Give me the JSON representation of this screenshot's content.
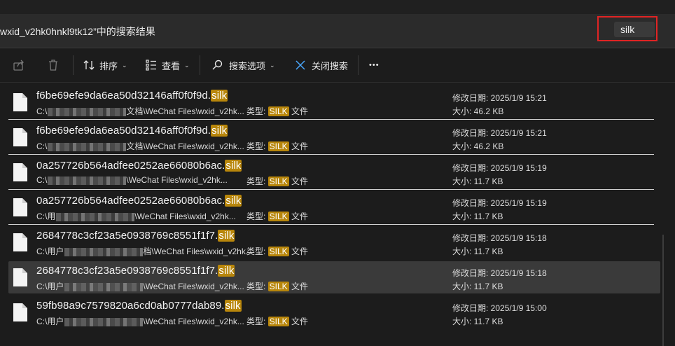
{
  "address": {
    "text": "wxid_v2hk0hnkl9tk12”中的搜索结果"
  },
  "search": {
    "value": "silk"
  },
  "toolbar": {
    "sort_label": "排序",
    "view_label": "查看",
    "search_options_label": "搜索选项",
    "close_search_label": "关闭搜索",
    "more_label": "•••"
  },
  "files": [
    {
      "name_prefix": "f6be69efe9da6ea50d32146aff0f0f9d.",
      "name_ext": "silk",
      "path_start": "C:\\",
      "path_end": "文档\\WeChat Files\\wxid_v2hk...",
      "type_label": "类型: ",
      "type_hl": "SILK",
      "type_suffix": " 文件",
      "date": "修改日期: 2025/1/9 15:21",
      "size": "大小: 46.2 KB"
    },
    {
      "name_prefix": "f6be69efe9da6ea50d32146aff0f0f9d.",
      "name_ext": "silk",
      "path_start": "C:\\",
      "path_end": "文档\\WeChat Files\\wxid_v2hk...",
      "type_label": "类型: ",
      "type_hl": "SILK",
      "type_suffix": " 文件",
      "date": "修改日期: 2025/1/9 15:21",
      "size": "大小: 46.2 KB"
    },
    {
      "name_prefix": "0a257726b564adfee0252ae66080b6ac.",
      "name_ext": "silk",
      "path_start": "C:\\",
      "path_end": "\\WeChat Files\\wxid_v2hk...",
      "type_label": "类型: ",
      "type_hl": "SILK",
      "type_suffix": " 文件",
      "date": "修改日期: 2025/1/9 15:19",
      "size": "大小: 11.7 KB"
    },
    {
      "name_prefix": "0a257726b564adfee0252ae66080b6ac.",
      "name_ext": "silk",
      "path_start": "C:\\用",
      "path_end": "\\WeChat Files\\wxid_v2hk...",
      "type_label": "类型: ",
      "type_hl": "SILK",
      "type_suffix": " 文件",
      "date": "修改日期: 2025/1/9 15:19",
      "size": "大小: 11.7 KB"
    },
    {
      "name_prefix": "2684778c3cf23a5e0938769c8551f1f7.",
      "name_ext": "silk",
      "path_start": "C:\\用户",
      "path_end": "档\\WeChat Files\\wxid_v2hk...",
      "type_label": "类型: ",
      "type_hl": "SILK",
      "type_suffix": " 文件",
      "date": "修改日期: 2025/1/9 15:18",
      "size": "大小: 11.7 KB"
    },
    {
      "name_prefix": "2684778c3cf23a5e0938769c8551f1f7.",
      "name_ext": "silk",
      "path_start": "C:\\用户",
      "path_end": "\\WeChat Files\\wxid_v2hk...",
      "type_label": "类型: ",
      "type_hl": "SILK",
      "type_suffix": " 文件",
      "date": "修改日期: 2025/1/9 15:18",
      "size": "大小: 11.7 KB"
    },
    {
      "name_prefix": "59fb98a9c7579820a6cd0ab0777dab89.",
      "name_ext": "silk",
      "path_start": "C:\\用户",
      "path_end": "\\WeChat Files\\wxid_v2hk...",
      "type_label": "类型: ",
      "type_hl": "SILK",
      "type_suffix": " 文件",
      "date": "修改日期: 2025/1/9 15:00",
      "size": "大小: 11.7 KB"
    }
  ],
  "selected_index": 5,
  "colors": {
    "highlight": "#b8860b",
    "search_outline": "#e02424",
    "background": "#1c1c1c"
  },
  "icons": [
    "share-icon",
    "delete-icon",
    "sort-icon",
    "view-icon",
    "search-options-icon",
    "close-icon",
    "file-icon"
  ]
}
